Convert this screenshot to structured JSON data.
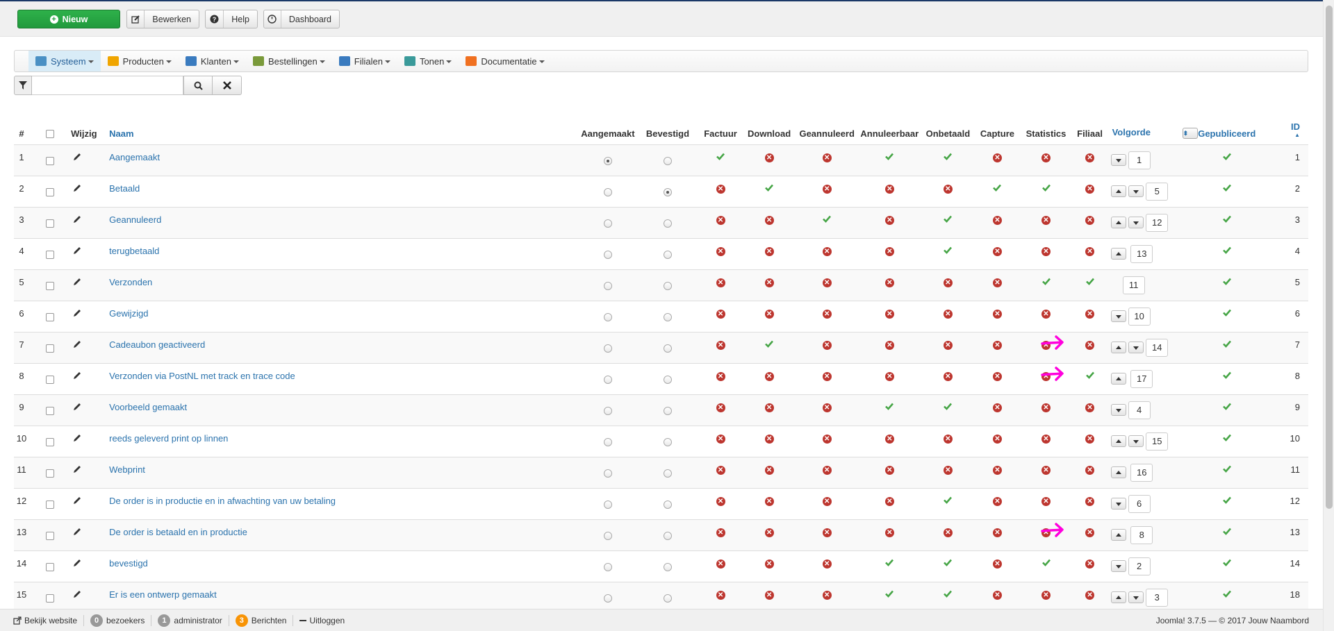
{
  "toolbar": {
    "new_label": "Nieuw",
    "edit_label": "Bewerken",
    "help_label": "Help",
    "dashboard_label": "Dashboard"
  },
  "menu": {
    "items": [
      {
        "label": "Systeem",
        "icon": "wrench-icon",
        "color": "#4a90c4"
      },
      {
        "label": "Producten",
        "icon": "box-icon",
        "color": "#f0a500"
      },
      {
        "label": "Klanten",
        "icon": "users-icon",
        "color": "#3a7bbf"
      },
      {
        "label": "Bestellingen",
        "icon": "pen-icon",
        "color": "#7a9a3a"
      },
      {
        "label": "Filialen",
        "icon": "tools-icon",
        "color": "#3a7bbf"
      },
      {
        "label": "Tonen",
        "icon": "monitor-icon",
        "color": "#3a9a9a"
      },
      {
        "label": "Documentatie",
        "icon": "puzzle-icon",
        "color": "#f07020"
      }
    ]
  },
  "search": {
    "value": "",
    "placeholder": ""
  },
  "table": {
    "headers": {
      "num": "#",
      "edit": "Wijzig",
      "name": "Naam",
      "created": "Aangemaakt",
      "confirmed": "Bevestigd",
      "invoice": "Factuur",
      "download": "Download",
      "cancelled": "Geannuleerd",
      "cancellable": "Annuleerbaar",
      "unpaid": "Onbetaald",
      "capture": "Capture",
      "statistics": "Statistics",
      "branch": "Filiaal",
      "order": "Volgorde",
      "published": "Gepubliceerd",
      "id": "ID"
    },
    "rows": [
      {
        "num": "1",
        "name": "Aangemaakt",
        "created": true,
        "confirmed": false,
        "flags": [
          1,
          0,
          0,
          1,
          1,
          0,
          0,
          0
        ],
        "up": false,
        "down": true,
        "order": "1",
        "id": "1"
      },
      {
        "num": "2",
        "name": "Betaald",
        "created": false,
        "confirmed": true,
        "flags": [
          0,
          1,
          0,
          0,
          0,
          1,
          1,
          0
        ],
        "up": true,
        "down": true,
        "order": "5",
        "id": "2"
      },
      {
        "num": "3",
        "name": "Geannuleerd",
        "created": false,
        "confirmed": false,
        "flags": [
          0,
          0,
          1,
          0,
          1,
          0,
          0,
          0
        ],
        "up": true,
        "down": true,
        "order": "12",
        "id": "3"
      },
      {
        "num": "4",
        "name": "terugbetaald",
        "created": false,
        "confirmed": false,
        "flags": [
          0,
          0,
          0,
          0,
          1,
          0,
          0,
          0
        ],
        "up": true,
        "down": false,
        "order": "13",
        "id": "4"
      },
      {
        "num": "5",
        "name": "Verzonden",
        "created": false,
        "confirmed": false,
        "flags": [
          0,
          0,
          0,
          0,
          0,
          0,
          1,
          1
        ],
        "up": false,
        "down": false,
        "order": "11",
        "id": "5"
      },
      {
        "num": "6",
        "name": "Gewijzigd",
        "created": false,
        "confirmed": false,
        "flags": [
          0,
          0,
          0,
          0,
          0,
          0,
          0,
          0
        ],
        "up": false,
        "down": true,
        "order": "10",
        "id": "6"
      },
      {
        "num": "7",
        "name": "Cadeaubon geactiveerd",
        "created": false,
        "confirmed": false,
        "flags": [
          0,
          1,
          0,
          0,
          0,
          0,
          0,
          0
        ],
        "up": true,
        "down": true,
        "order": "14",
        "id": "7",
        "arrow": true
      },
      {
        "num": "8",
        "name": "Verzonden via PostNL met track en trace code",
        "created": false,
        "confirmed": false,
        "flags": [
          0,
          0,
          0,
          0,
          0,
          0,
          0,
          1
        ],
        "up": true,
        "down": false,
        "order": "17",
        "id": "8",
        "arrow": true
      },
      {
        "num": "9",
        "name": "Voorbeeld gemaakt",
        "created": false,
        "confirmed": false,
        "flags": [
          0,
          0,
          0,
          1,
          1,
          0,
          0,
          0
        ],
        "up": false,
        "down": true,
        "order": "4",
        "id": "9"
      },
      {
        "num": "10",
        "name": "reeds geleverd print op linnen",
        "created": false,
        "confirmed": false,
        "flags": [
          0,
          0,
          0,
          0,
          0,
          0,
          0,
          0
        ],
        "up": true,
        "down": true,
        "order": "15",
        "id": "10"
      },
      {
        "num": "11",
        "name": "Webprint",
        "created": false,
        "confirmed": false,
        "flags": [
          0,
          0,
          0,
          0,
          0,
          0,
          0,
          0
        ],
        "up": true,
        "down": false,
        "order": "16",
        "id": "11"
      },
      {
        "num": "12",
        "name": "De order is in productie en in afwachting van uw betaling",
        "created": false,
        "confirmed": false,
        "flags": [
          0,
          0,
          0,
          0,
          1,
          0,
          0,
          0
        ],
        "up": false,
        "down": true,
        "order": "6",
        "id": "12"
      },
      {
        "num": "13",
        "name": "De order is betaald en in productie",
        "created": false,
        "confirmed": false,
        "flags": [
          0,
          0,
          0,
          0,
          0,
          0,
          0,
          0
        ],
        "up": true,
        "down": false,
        "order": "8",
        "id": "13",
        "arrow": true
      },
      {
        "num": "14",
        "name": "bevestigd",
        "created": false,
        "confirmed": false,
        "flags": [
          0,
          0,
          0,
          1,
          1,
          0,
          1,
          0
        ],
        "up": false,
        "down": true,
        "order": "2",
        "id": "14"
      },
      {
        "num": "15",
        "name": "Er is een ontwerp gemaakt",
        "created": false,
        "confirmed": false,
        "flags": [
          0,
          0,
          0,
          1,
          1,
          0,
          0,
          0
        ],
        "up": true,
        "down": true,
        "order": "3",
        "id": "18"
      }
    ]
  },
  "statusbar": {
    "view_site": "Bekijk website",
    "visitors_count": "0",
    "visitors_label": "bezoekers",
    "admin_count": "1",
    "admin_label": "administrator",
    "messages_count": "3",
    "messages_label": "Berichten",
    "logout": "Uitloggen",
    "copyright": "Joomla! 3.7.5  —  © 2017 Jouw Naambord"
  },
  "colors": {
    "ok": "#46a546",
    "no": "#bd362f",
    "link": "#2b73ad",
    "arrow": "#ff00dd",
    "new": "#2eb14a"
  }
}
